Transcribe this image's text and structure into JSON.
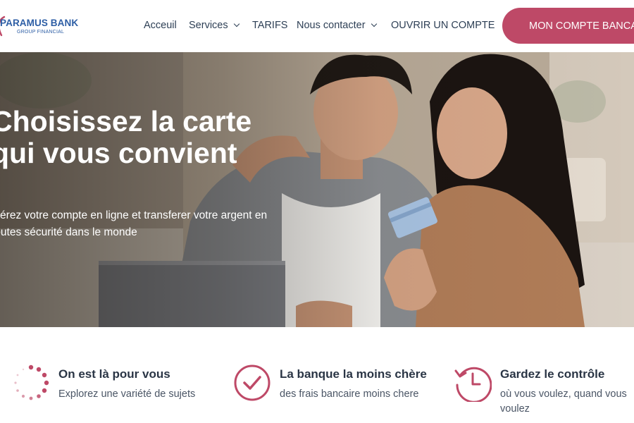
{
  "brand": {
    "name": "PARAMUS BANK",
    "tagline": "GROUP FINANCIAL",
    "accent_color": "#be4967",
    "brand_blue": "#2d5ea5"
  },
  "nav": {
    "items": [
      {
        "label": "Acceuil",
        "dropdown": false
      },
      {
        "label": "Services",
        "dropdown": true
      },
      {
        "label": "TARIFS",
        "dropdown": false
      },
      {
        "label": "Nous contacter",
        "dropdown": true
      },
      {
        "label": "OUVRIR UN COMPTE",
        "dropdown": false
      }
    ],
    "cta_label": "MON COMPTE BANCAIRE"
  },
  "hero": {
    "title": "Choisissez la carte qui vous convient",
    "subtitle": "Gérez votre compte en ligne et transferer votre argent en toutes sécurité dans le monde"
  },
  "features": [
    {
      "icon": "loading-dots-icon",
      "title": "On est là pour vous",
      "desc": "Explorez une variété de sujets"
    },
    {
      "icon": "check-circle-icon",
      "title": "La banque la moins chère",
      "desc": "des frais bancaire moins chere"
    },
    {
      "icon": "history-clock-icon",
      "title": "Gardez le contrôle",
      "desc": "où vous voulez, quand vous voulez"
    }
  ]
}
